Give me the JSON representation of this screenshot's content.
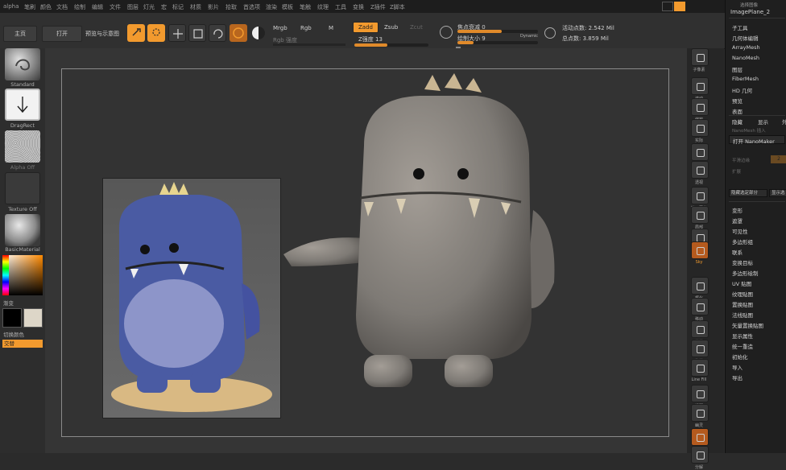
{
  "menu": {
    "items": [
      "alpha",
      "笔刷",
      "颜色",
      "文档",
      "绘制",
      "编辑",
      "文件",
      "图层",
      "灯光",
      "宏",
      "标记",
      "材质",
      "影片",
      "拾取",
      "首选项",
      "渲染",
      "模板",
      "笔触",
      "纹理",
      "工具",
      "变换",
      "Z插件",
      "Z脚本"
    ]
  },
  "toolbar": {
    "btn_lightbox": "主页",
    "btn_open": "打开",
    "label_lightbox_more": "预览与示意图",
    "btn_edit": "Edit",
    "btn_draw": "Draw",
    "btn_move": "移动",
    "btn_scale": "缩放",
    "btn_rotate": "旋转",
    "mrgb": "Mrgb",
    "rgb": "Rgb",
    "m": "M",
    "rgb_intensity": "Rgb 强度",
    "zadd": "Zadd",
    "zsub": "Zsub",
    "zcut": "Zcut",
    "z_intensity_label": "Z强度",
    "z_intensity_value": "13",
    "focal_shift_label": "焦点衰减",
    "focal_shift_value": "0",
    "draw_size_label": "绘制大小",
    "draw_size_value": "9",
    "dynamic": "Dynamic",
    "active_points": "活动点数: 2.542 Mil",
    "total_points": "总点数: 3.859 Mil",
    "focal_slider": 0.55,
    "drawsize_slider": 0.2,
    "z_slider": 0.45
  },
  "left": {
    "brush_label": "Standard",
    "stroke_label": "DragRect",
    "alpha_label": "Alpha Off",
    "texture_label": "Texture Off",
    "material_label": "BasicMaterial",
    "gradient_label": "渐变",
    "switch_color_label": "切换颜色",
    "alternate_label": "交替"
  },
  "right_strip": [
    {
      "name": "subtool-icon",
      "label": "子像素"
    },
    {
      "name": "scroll-icon",
      "label": "滚动"
    },
    {
      "name": "zoom-icon",
      "label": "缩放"
    },
    {
      "name": "actual-icon",
      "label": "实际"
    },
    {
      "name": "aahalf-icon",
      "label": "AAHalf"
    },
    {
      "name": "persp-icon",
      "label": "透视"
    },
    {
      "name": "floor-icon",
      "label": "地面网格"
    },
    {
      "name": "local-icon",
      "label": "局部"
    },
    {
      "name": "lsym-icon",
      "label": "L.Sym"
    },
    {
      "name": "xyz-icon",
      "label": "Sky"
    },
    {
      "name": "frame-icon",
      "label": "框化"
    },
    {
      "name": "move-icon",
      "label": "移动"
    },
    {
      "name": "scale-icon",
      "label": "缩放"
    },
    {
      "name": "rotate-icon",
      "label": "旋转"
    },
    {
      "name": "linefill-icon",
      "label": "Line Fill"
    },
    {
      "name": "transp-icon",
      "label": "透明"
    },
    {
      "name": "ghost-icon",
      "label": "幽灵"
    },
    {
      "name": "solo-icon",
      "label": "单独"
    },
    {
      "name": "xpose-icon",
      "label": "分解"
    }
  ],
  "rightpanel": {
    "top_label": "ImagePlane_2",
    "top_small": "选择图像",
    "items_a": [
      "子工具",
      "几何体编辑",
      "ArrayMesh",
      "NanoMesh",
      "图层",
      "FiberMesh",
      "HD 几何",
      "预览",
      "表面"
    ],
    "tabs": [
      "隐藏",
      "显示",
      "外部"
    ],
    "dim1": "NanoMesh 插入",
    "btn_nanomaker": "打开 NanoMaker",
    "dim2": "平滑边缘",
    "dim2_value": "2",
    "dim3": "扩展",
    "btn_pl": "隐藏选定部分",
    "btn_pr": "显示选定部分",
    "items_b": [
      "变形",
      "遮罩",
      "可见性",
      "多边形组",
      "联系",
      "变换目标",
      "多边形绘制",
      "UV 贴图",
      "纹理贴图",
      "置换贴图",
      "法线贴图",
      "矢量置换贴图",
      "显示属性",
      "统一重造",
      "初始化",
      "导入",
      "导出"
    ]
  },
  "colors": {
    "accent": "#f29a2e",
    "panel": "#1f1f1f",
    "canvas": "#353535"
  }
}
